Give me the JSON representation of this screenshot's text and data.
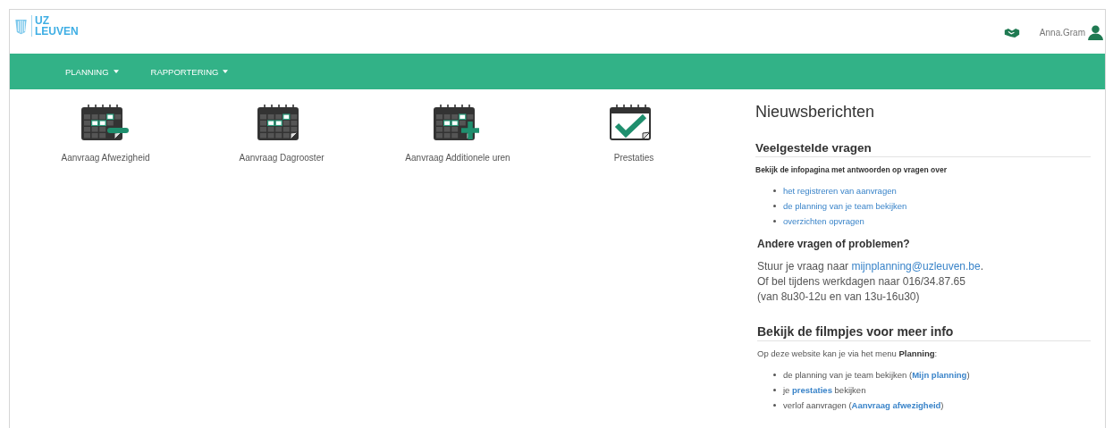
{
  "header": {
    "logo": {
      "line1": "UZ",
      "line2": "LEUVEN"
    },
    "user": "Anna.Gram"
  },
  "nav": [
    {
      "label": "PLANNING",
      "dropdown": true
    },
    {
      "label": "RAPPORTERING",
      "dropdown": true
    }
  ],
  "tiles": [
    {
      "label": "Aanvraag Afwezigheid",
      "kind": "minus"
    },
    {
      "label": "Aanvraag Dagrooster",
      "kind": "grid"
    },
    {
      "label": "Aanvraag Additionele uren",
      "kind": "plus"
    },
    {
      "label": "Prestaties",
      "kind": "check"
    }
  ],
  "news": {
    "title": "Nieuwsberichten",
    "faq": {
      "heading": "Veelgestelde vragen",
      "intro": "Bekijk de infopagina met antwoorden op vragen over",
      "links": [
        "het registreren van aanvragen",
        "de planning van je team bekijken",
        "overzichten opvragen"
      ]
    },
    "other": {
      "heading": "Andere vragen of problemen?",
      "lines": [
        [
          {
            "kind": "text",
            "text": "Stuur je vraag naar "
          },
          {
            "kind": "link",
            "text": "mijnplanning@uzleuven.be"
          },
          {
            "kind": "text",
            "text": "."
          }
        ],
        [
          {
            "kind": "text",
            "text": "Of bel tijdens werkdagen naar 016/34.87.65"
          }
        ],
        [
          {
            "kind": "text",
            "text": "(van 8u30-12u en van 13u-16u30)"
          }
        ]
      ]
    },
    "videos": {
      "heading": "Bekijk de filmpjes voor meer info",
      "intro": "Op deze website kan je via het menu **Planning**:",
      "items": [
        [
          {
            "kind": "text",
            "text": "de planning van je team bekijken ("
          },
          {
            "kind": "link",
            "text": "Mijn planning"
          },
          {
            "kind": "text",
            "text": ")"
          }
        ],
        [
          {
            "kind": "text",
            "text": "je "
          },
          {
            "kind": "link",
            "text": "prestaties"
          },
          {
            "kind": "text",
            "text": " bekijken"
          }
        ],
        [
          {
            "kind": "text",
            "text": "verlof aanvragen ("
          },
          {
            "kind": "link",
            "text": "Aanvraag afwezigheid"
          },
          {
            "kind": "text",
            "text": ")"
          }
        ]
      ]
    }
  }
}
